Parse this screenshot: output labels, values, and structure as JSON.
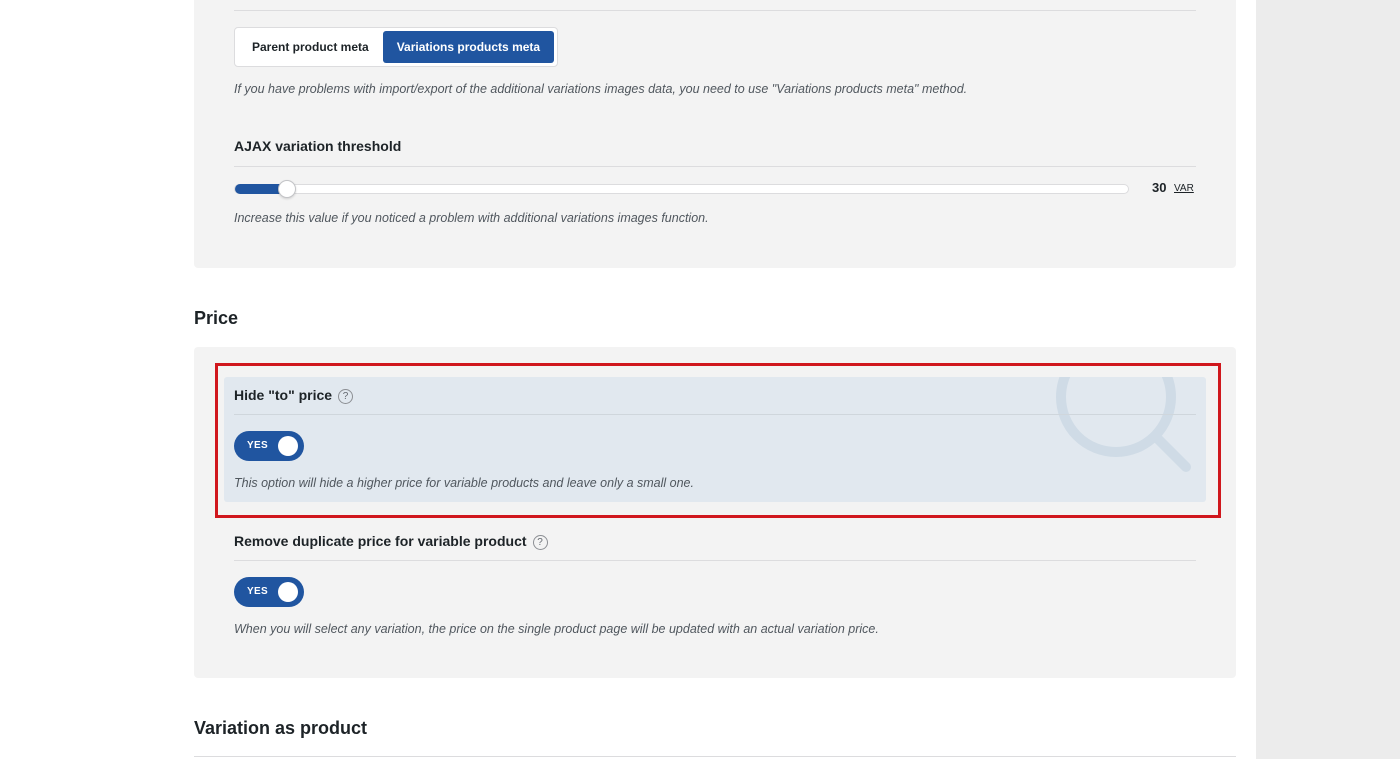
{
  "variations_meta": {
    "method_options": [
      "Parent product meta",
      "Variations products meta"
    ],
    "selected_method": "Variations products meta",
    "method_help": "If you have problems with import/export of the additional variations images data, you need to use \"Variations products meta\" method.",
    "ajax_threshold": {
      "title": "AJAX variation threshold",
      "value": "30",
      "unit": "VAR",
      "slider_fraction": 0.058,
      "help": "Increase this value if you noticed a problem with additional variations images function."
    }
  },
  "price_section": {
    "heading": "Price",
    "hide_to_price": {
      "title": "Hide \"to\" price",
      "help_icon": "?",
      "toggle_label": "YES",
      "help": "This option will hide a higher price for variable products and leave only a small one."
    },
    "remove_duplicate_price": {
      "title": "Remove duplicate price for variable product",
      "help_icon": "?",
      "toggle_label": "YES",
      "help": "When you will select any variation, the price on the single product page will be updated with an actual variation price."
    }
  },
  "variation_as_product_section": {
    "heading": "Variation as product"
  },
  "colors": {
    "accent": "#2055a0",
    "highlight_border": "#d0171d",
    "highlight_bg": "#e1e8ef",
    "panel_bg": "#f3f3f3"
  },
  "icons": {
    "help": "question-circle-icon",
    "search_watermark": "search-icon"
  }
}
